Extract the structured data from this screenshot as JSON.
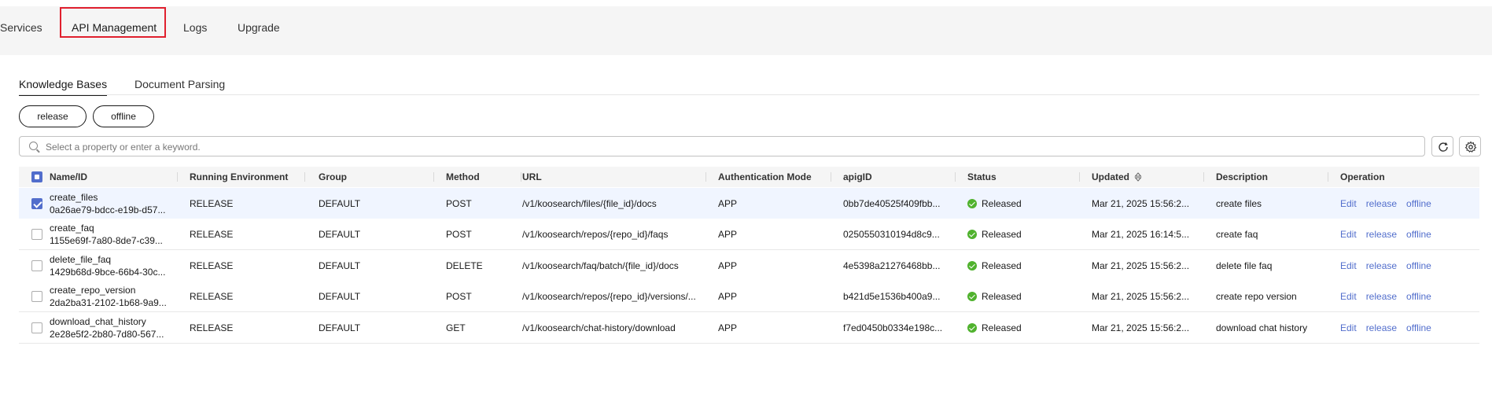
{
  "top_tabs": [
    {
      "label": "Services"
    },
    {
      "label": "API Management"
    },
    {
      "label": "Logs"
    },
    {
      "label": "Upgrade"
    }
  ],
  "sub_tabs": [
    {
      "label": "Knowledge Bases"
    },
    {
      "label": "Document Parsing"
    }
  ],
  "actions": {
    "release_label": "release",
    "offline_label": "offline"
  },
  "search": {
    "placeholder": "Select a property or enter a keyword."
  },
  "table": {
    "columns": {
      "name": "Name/ID",
      "env": "Running Environment",
      "group": "Group",
      "method": "Method",
      "url": "URL",
      "auth": "Authentication Mode",
      "apigid": "apigID",
      "status": "Status",
      "updated": "Updated",
      "description": "Description",
      "operation": "Operation"
    },
    "rows": [
      {
        "name": "create_files",
        "id": "0a26ae79-bdcc-e19b-d57...",
        "env": "RELEASE",
        "group": "DEFAULT",
        "method": "POST",
        "url": "/v1/koosearch/files/{file_id}/docs",
        "auth": "APP",
        "apigid": "0bb7de40525f409fbb...",
        "status": "Released",
        "updated": "Mar 21, 2025 15:56:2...",
        "description": "create files",
        "op_edit": "Edit",
        "op_release": "release",
        "op_offline": "offline"
      },
      {
        "name": "create_faq",
        "id": "1155e69f-7a80-8de7-c39...",
        "env": "RELEASE",
        "group": "DEFAULT",
        "method": "POST",
        "url": "/v1/koosearch/repos/{repo_id}/faqs",
        "auth": "APP",
        "apigid": "0250550310194d8c9...",
        "status": "Released",
        "updated": "Mar 21, 2025 16:14:5...",
        "description": "create faq",
        "op_edit": "Edit",
        "op_release": "release",
        "op_offline": "offline"
      },
      {
        "name": "delete_file_faq",
        "id": "1429b68d-9bce-66b4-30c...",
        "env": "RELEASE",
        "group": "DEFAULT",
        "method": "DELETE",
        "url": "/v1/koosearch/faq/batch/{file_id}/docs",
        "auth": "APP",
        "apigid": "4e5398a21276468bb...",
        "status": "Released",
        "updated": "Mar 21, 2025 15:56:2...",
        "description": "delete file faq",
        "op_edit": "Edit",
        "op_release": "release",
        "op_offline": "offline"
      },
      {
        "name": "create_repo_version",
        "id": "2da2ba31-2102-1b68-9a9...",
        "env": "RELEASE",
        "group": "DEFAULT",
        "method": "POST",
        "url": "/v1/koosearch/repos/{repo_id}/versions/...",
        "auth": "APP",
        "apigid": "b421d5e1536b400a9...",
        "status": "Released",
        "updated": "Mar 21, 2025 15:56:2...",
        "description": "create repo version",
        "op_edit": "Edit",
        "op_release": "release",
        "op_offline": "offline"
      },
      {
        "name": "download_chat_history",
        "id": "2e28e5f2-2b80-7d80-567...",
        "env": "RELEASE",
        "group": "DEFAULT",
        "method": "GET",
        "url": "/v1/koosearch/chat-history/download",
        "auth": "APP",
        "apigid": "f7ed0450b0334e198c...",
        "status": "Released",
        "updated": "Mar 21, 2025 15:56:2...",
        "description": "download chat history",
        "op_edit": "Edit",
        "op_release": "release",
        "op_offline": "offline"
      }
    ]
  },
  "colors": {
    "accent": "#526ecc",
    "released": "#50b22e",
    "highlight": "#e0202e"
  },
  "icons": {
    "search": "search-icon",
    "refresh": "refresh-icon",
    "settings": "gear-icon",
    "sort": "sort-icon"
  }
}
